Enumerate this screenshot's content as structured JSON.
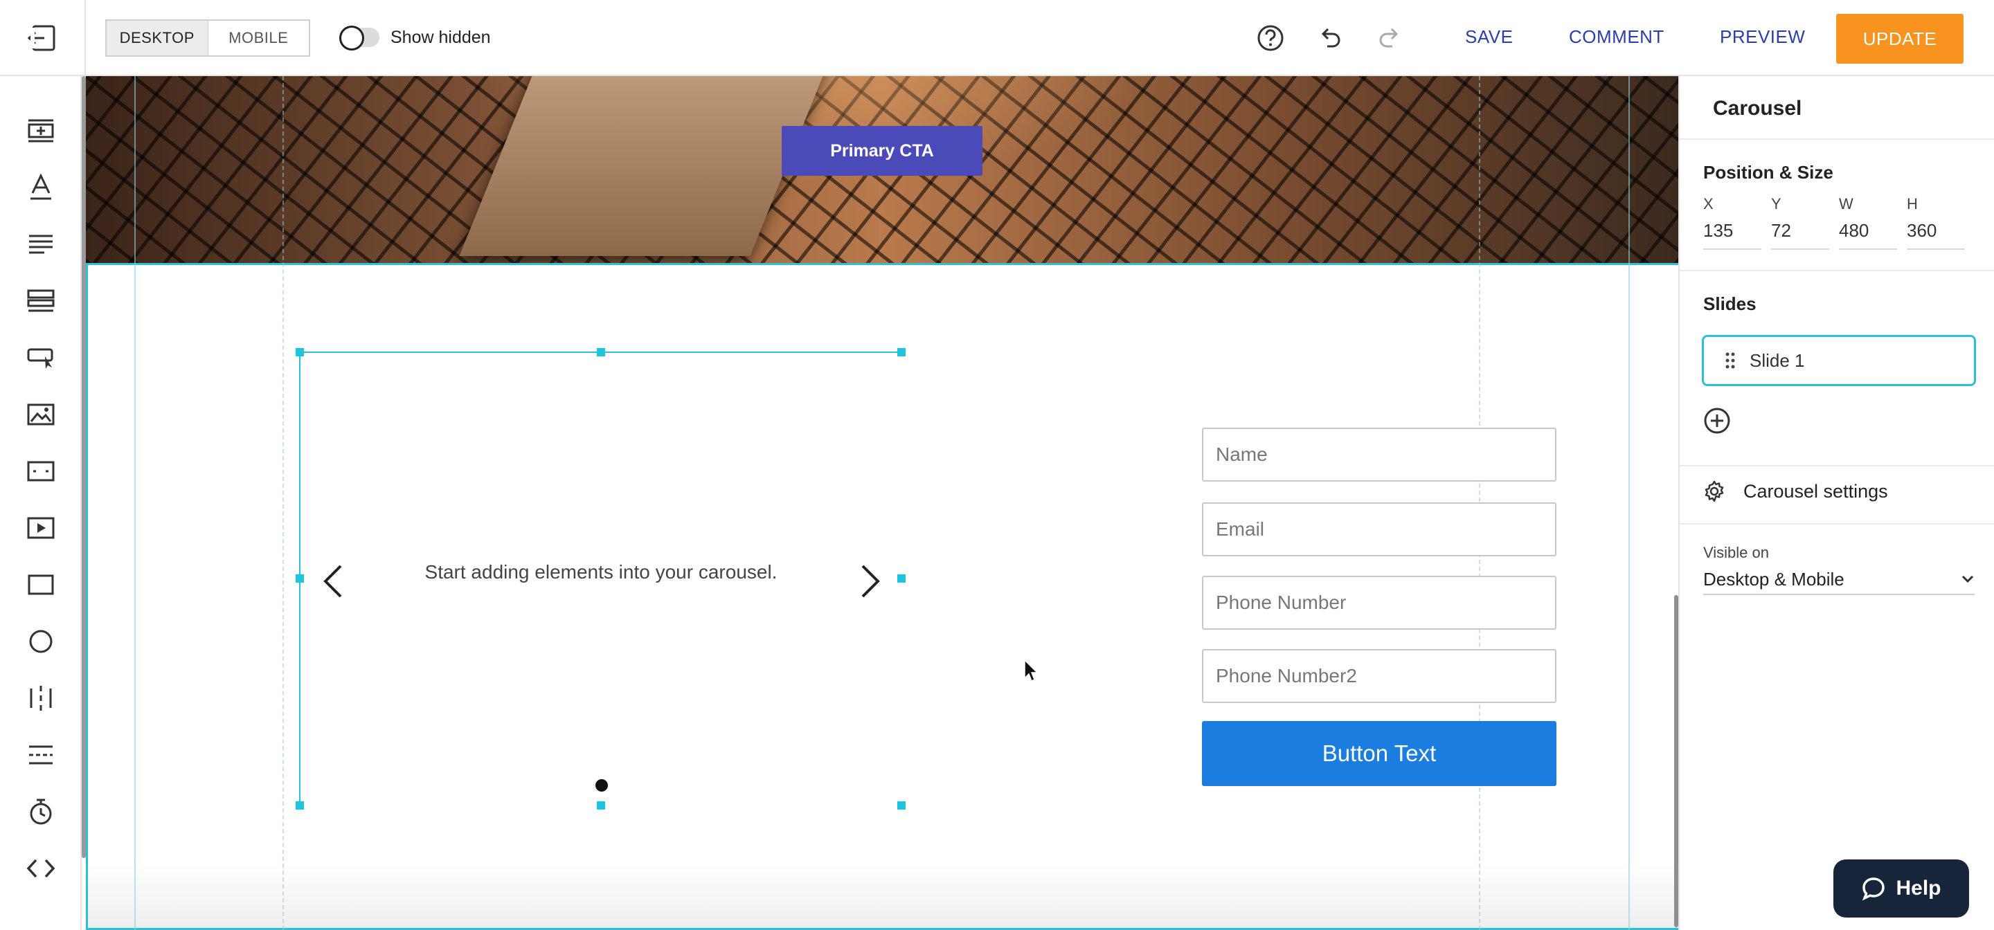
{
  "toolbar": {
    "device_tabs": [
      "DESKTOP",
      "MOBILE"
    ],
    "active_device": "DESKTOP",
    "show_hidden_label": "Show hidden",
    "save_label": "SAVE",
    "comment_label": "COMMENT",
    "preview_label": "PREVIEW",
    "update_label": "UPDATE"
  },
  "left_tools": [
    "add-section-icon",
    "text-icon",
    "paragraph-icon",
    "rows-icon",
    "button-icon",
    "image-icon",
    "divider-box-icon",
    "video-icon",
    "rectangle-icon",
    "circle-icon",
    "columns-icon",
    "separator-icon",
    "timer-icon",
    "code-icon"
  ],
  "canvas": {
    "primary_cta": "Primary CTA",
    "carousel_placeholder": "Start adding elements into your carousel.",
    "form_fields": [
      "Name",
      "Email",
      "Phone Number",
      "Phone Number2"
    ],
    "form_button": "Button Text"
  },
  "panel": {
    "title": "Carousel",
    "position_size_label": "Position & Size",
    "position": {
      "x_label": "X",
      "x": "135",
      "y_label": "Y",
      "y": "72",
      "w_label": "W",
      "w": "480",
      "h_label": "H",
      "h": "360"
    },
    "slides_label": "Slides",
    "slides": [
      "Slide 1"
    ],
    "settings_label": "Carousel settings",
    "visible_on_label": "Visible on",
    "visible_on_value": "Desktop & Mobile"
  },
  "help_label": "Help",
  "colors": {
    "accent_orange": "#f7931e",
    "link_blue": "#2b3ea8",
    "selection_cyan": "#2bc0d8",
    "cta_purple": "#4a4ab8",
    "form_button_blue": "#1b7ddf",
    "help_navy": "#16253a"
  }
}
